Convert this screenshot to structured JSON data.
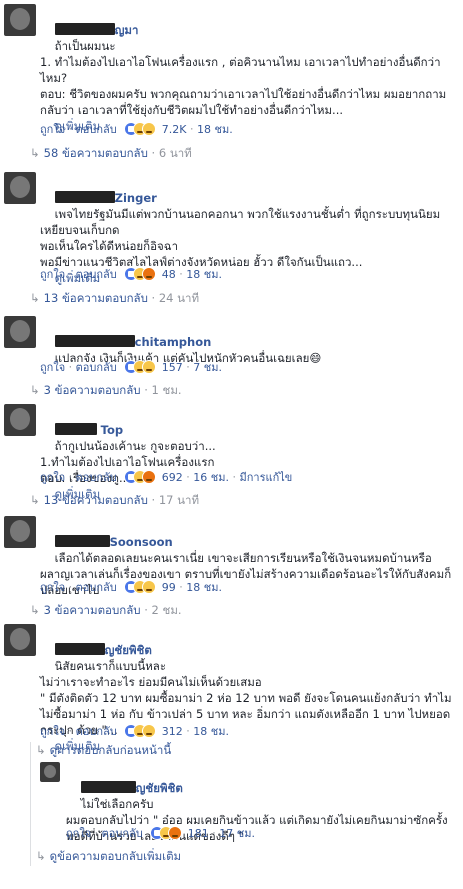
{
  "actions": {
    "like": "ถูกใจ",
    "reply": "ตอบกลับ",
    "dot": "·"
  },
  "comments": [
    {
      "name": "ญมา",
      "text": "ถ้าเป็นผมนะ\n1. ทำไมต้องไปเอาไอโฟนเครื่องแรก , ต่อคิวนานไหม เอาเวลาไปทำอย่างอื่นดีกว่าไหม?\nตอบ: ชีวิตของผมครับ พวกคุณถามว่าเอาเวลาไปใช้อย่างอื่นดีกว่าไหม ผมอยากถามกลับว่า เอาเวลาที่ใช้ยุ่งกับชีวิตผมไปใช้ทำอย่างอื่นดีกว่าไหม...",
      "see_more": "ดูเพิ่มเติม",
      "reactions": "7.2K",
      "time": "18 ชม.",
      "replies": "58 ข้อความตอบกลับ",
      "replies_time": "6 นาที"
    },
    {
      "name": "Zinger",
      "text": "เพจไทยรัฐมันมีแต่พวกบ้านนอกคอกนา พวกใช้แรงงานชั้นต่ำ ที่ถูกระบบทุนนิยมเหยียบจนเก็บกด\nพอเห็นใครได้ดีหน่อยก็อิจฉา\nพอมีข่าวแนวชีวิตสไลไลฟ์ต่างจังหวัดหน่อย ฮั้วว ดีใจกันเป็นแถว...",
      "see_more": "ดูเพิ่มเติม",
      "reactions": "48",
      "time": "18 ชม.",
      "replies": "13 ข้อความตอบกลับ",
      "replies_time": "24 นาที"
    },
    {
      "name": "chitamphon",
      "text": "แปลกจัง เงินก็เงินเค้า แต่คันไปหนักหัวคนอื่นเฉยเลย😄",
      "reactions": "157",
      "time": "7 ชม.",
      "replies": "3 ข้อความตอบกลับ",
      "replies_time": "1 ชม."
    },
    {
      "name": "Top",
      "text": "ถ้ากูเปนน้องเค้านะ กูจะตอบว่า...\n1.ทำไมต้องไปเอาไอโฟนเครื่องแรก\nตอบ. เรื่องของกู...",
      "see_more": "ดูเพิ่มเติม",
      "reactions": "692",
      "time": "16 ชม.",
      "edited": "มีการแก้ไข",
      "replies": "13 ข้อความตอบกลับ",
      "replies_time": "17 นาที"
    },
    {
      "name": "Soonsoon",
      "text": "เลือกได้ตลอดเลยนะคนเราเนี่ย เขาจะเสียการเรียนหรือใช้เงินจนหมดบ้านหรือผลาญเวลาเล่นก็เรื่องของเขา ตราบที่เขายังไม่สร้างความเดือดร้อนอะไรให้กับสังคมก็ปล่อยเขาไป",
      "reactions": "99",
      "time": "18 ชม.",
      "replies": "3 ข้อความตอบกลับ",
      "replies_time": "2 ชม."
    },
    {
      "name": "ญชัยพิชิต",
      "text": "นิสัยคนเราก็แบบนี้หละ\nไม่ว่าเราจะทำอะไร ย่อมมีคนไม่เห็นด้วยเสมอ\n\" มีตังติดตัว 12 บาท ผมซื้อมาม่า 2 ห่อ 12 บาท พอดี ยังจะโดนคนแย้งกลับว่า ทำไมไม่ซื้อมาม่า 1 ห่อ กับ ข้าวเปล่า 5 บาท หละ อิ่มกว่า แถมตังเหลืออีก 1 บาท ไปหยอดกระปุก ด้วย \"...",
      "see_more": "ดูเพิ่มเติม",
      "reactions": "312",
      "time": "18 ชม.",
      "prev_replies": "ดูการตอบกลับก่อนหน้านี้"
    }
  ],
  "nested_reply": {
    "name": "ญชัยพิชิต",
    "text": "ไม่ใช่เลือกครับ\nผมตอบกลับไปว่า \" อ๋ออ ผมเคยกินข้าวแล้ว แต่เกิดมายังไม่เคยกินมาม่าซักครั้ง พอดีที่บ้านรวย เลยได้กินแต่ของดีๆ \"",
    "reactions": "181",
    "time": "17 ชม."
  },
  "more_replies": "ดูข้อความตอบกลับเพิ่มเติม"
}
